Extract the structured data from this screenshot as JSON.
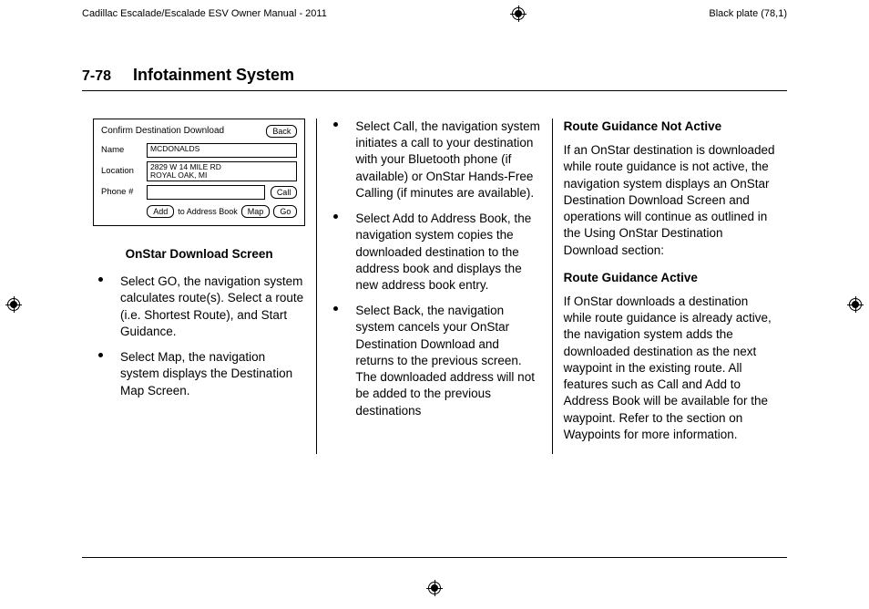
{
  "header": {
    "manual_title": "Cadillac Escalade/Escalade ESV Owner Manual - 2011",
    "plate": "Black plate (78,1)"
  },
  "page": {
    "number": "7-78",
    "section": "Infotainment System"
  },
  "figure": {
    "title": "Confirm Destination Download",
    "back": "Back",
    "name_label": "Name",
    "name_value": "MCDONALDS",
    "loc_label": "Location",
    "loc_value": "2829 W 14 MILE RD\nROYAL OAK, MI",
    "phone_label": "Phone #",
    "call": "Call",
    "add": "Add",
    "to_ab": "to Address Book",
    "map": "Map",
    "go": "Go"
  },
  "col1": {
    "caption": "OnStar Download Screen",
    "b1": "Select GO, the navigation system calculates route(s). Select a route (i.e. Shortest Route), and Start Guidance.",
    "b2": "Select Map, the navigation system displays the Destination Map Screen."
  },
  "col2": {
    "b1": "Select Call, the navigation system initiates a call to your destination with your Bluetooth phone (if available) or OnStar Hands-Free Calling (if minutes are available).",
    "b2": "Select Add to Address Book, the navigation system copies the downloaded destination to the address book and displays the new address book entry.",
    "b3": "Select Back, the navigation system cancels your OnStar Destination Download and returns to the previous screen. The downloaded address will not be added to the previous destinations"
  },
  "col3": {
    "h1": "Route Guidance Not Active",
    "p1": "If an OnStar destination is downloaded while route guidance is not active, the navigation system displays an OnStar Destination Download Screen and operations will continue as outlined in the Using OnStar Destination Download section:",
    "h2": "Route Guidance Active",
    "p2": "If OnStar downloads a destination while route guidance is already active, the navigation system adds the downloaded destination as the next waypoint in the existing route. All features such as Call and Add to Address Book will be available for the waypoint. Refer to the section on Waypoints for more information."
  }
}
